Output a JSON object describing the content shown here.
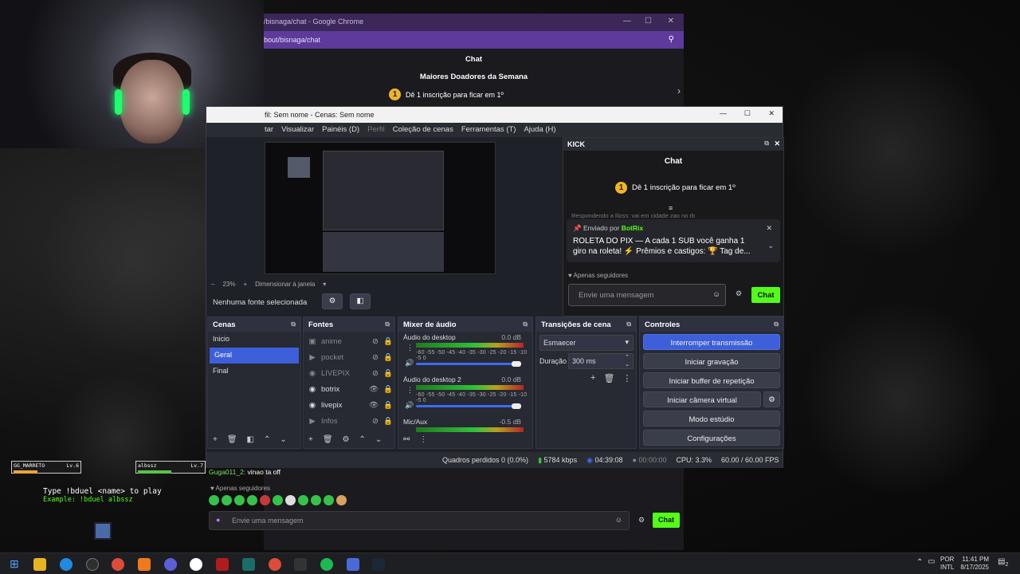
{
  "chrome": {
    "title": "/bisnaga/chat - Google Chrome",
    "url": "bout/bisnaga/chat",
    "chat_header": "Chat",
    "top_donors": "Maiores Doadores da Semana",
    "donor_cta": "Dê 1 inscrição para ficar em 1º",
    "donor_rank": "1",
    "chat_line_user": "Guga011_2:",
    "chat_line_text": "vinao ta off",
    "followers_only": "Apenas seguidores",
    "input_placeholder": "Envie uma mensagem",
    "chat_button": "Chat"
  },
  "obs": {
    "title": "fil: Sem nome - Cenas: Sem nome",
    "menu": [
      "tar",
      "Visualizar",
      "Painéis (D)",
      "Perfil",
      "Coleção de cenas",
      "Ferramentas (T)",
      "Ajuda (H)"
    ],
    "zoom": "23%",
    "resize_label": "Dimensionar à janela",
    "no_source": "Nenhuma fonte selecionada",
    "scenes_title": "Cenas",
    "scenes": [
      "Inicio",
      "Geral",
      "Final"
    ],
    "sources_title": "Fontes",
    "sources": [
      "anime",
      "pocket",
      "LIVEPIX",
      "botrix",
      "livepix",
      "Infos"
    ],
    "mixer_title": "Mixer de áudio",
    "mixer": [
      {
        "name": "Áudio do desktop",
        "db": "0.0 dB"
      },
      {
        "name": "Áudio do desktop 2",
        "db": "0.0 dB"
      },
      {
        "name": "Mic/Aux",
        "db": "-0.5 dB"
      }
    ],
    "meter_ticks": "-60 -55 -50 -45 -40 -35 -30 -25 -20 -15 -10 -5 0",
    "transitions_title": "Transições de cena",
    "transition": "Esmaecer",
    "duration_label": "Duração",
    "duration": "300 ms",
    "controls_title": "Controles",
    "controls": [
      "Interromper transmissão",
      "Iniciar gravação",
      "Iniciar buffer de repetição",
      "Iniciar câmera virtual",
      "Modo estúdio",
      "Configurações"
    ],
    "status": {
      "dropped": "Quadros perdidos 0 (0.0%)",
      "bitrate": "5784 kbps",
      "live_time": "04:39:08",
      "rec_time": "00:00:00",
      "cpu": "CPU: 3.3%",
      "fps": "60.00 / 60.00 FPS"
    }
  },
  "kick": {
    "dock_title": "KICK",
    "chat_header": "Chat",
    "donor_cta": "Dê 1 inscrição para ficar em 1º",
    "donor_rank": "1",
    "reply_line": "Respondendo a lilzss: vai em cidade zao no rb",
    "pinned_by": "Enviado por",
    "pinned_user": "BotRix",
    "pinned_msg": "ROLETA DO PIX — A cada 1 SUB você ganha 1 giro na roleta! ⚡ Prêmios e castigos: 🏆 Tag de...",
    "followers_only": "Apenas seguidores",
    "input_placeholder": "Envie uma mensagem",
    "chat_button": "Chat"
  },
  "overlay": {
    "player1": "GG_MARRETO",
    "player1_lv": "Lv.6",
    "player2": "albssz",
    "player2_lv": "Lv.7",
    "hint1": "Type !bduel <name> to play",
    "hint2": "Example: !bduel albssz"
  },
  "taskbar": {
    "lang": "POR",
    "layout": "INTL",
    "time": "11:41 PM",
    "date": "8/17/2025",
    "notif": "2"
  }
}
